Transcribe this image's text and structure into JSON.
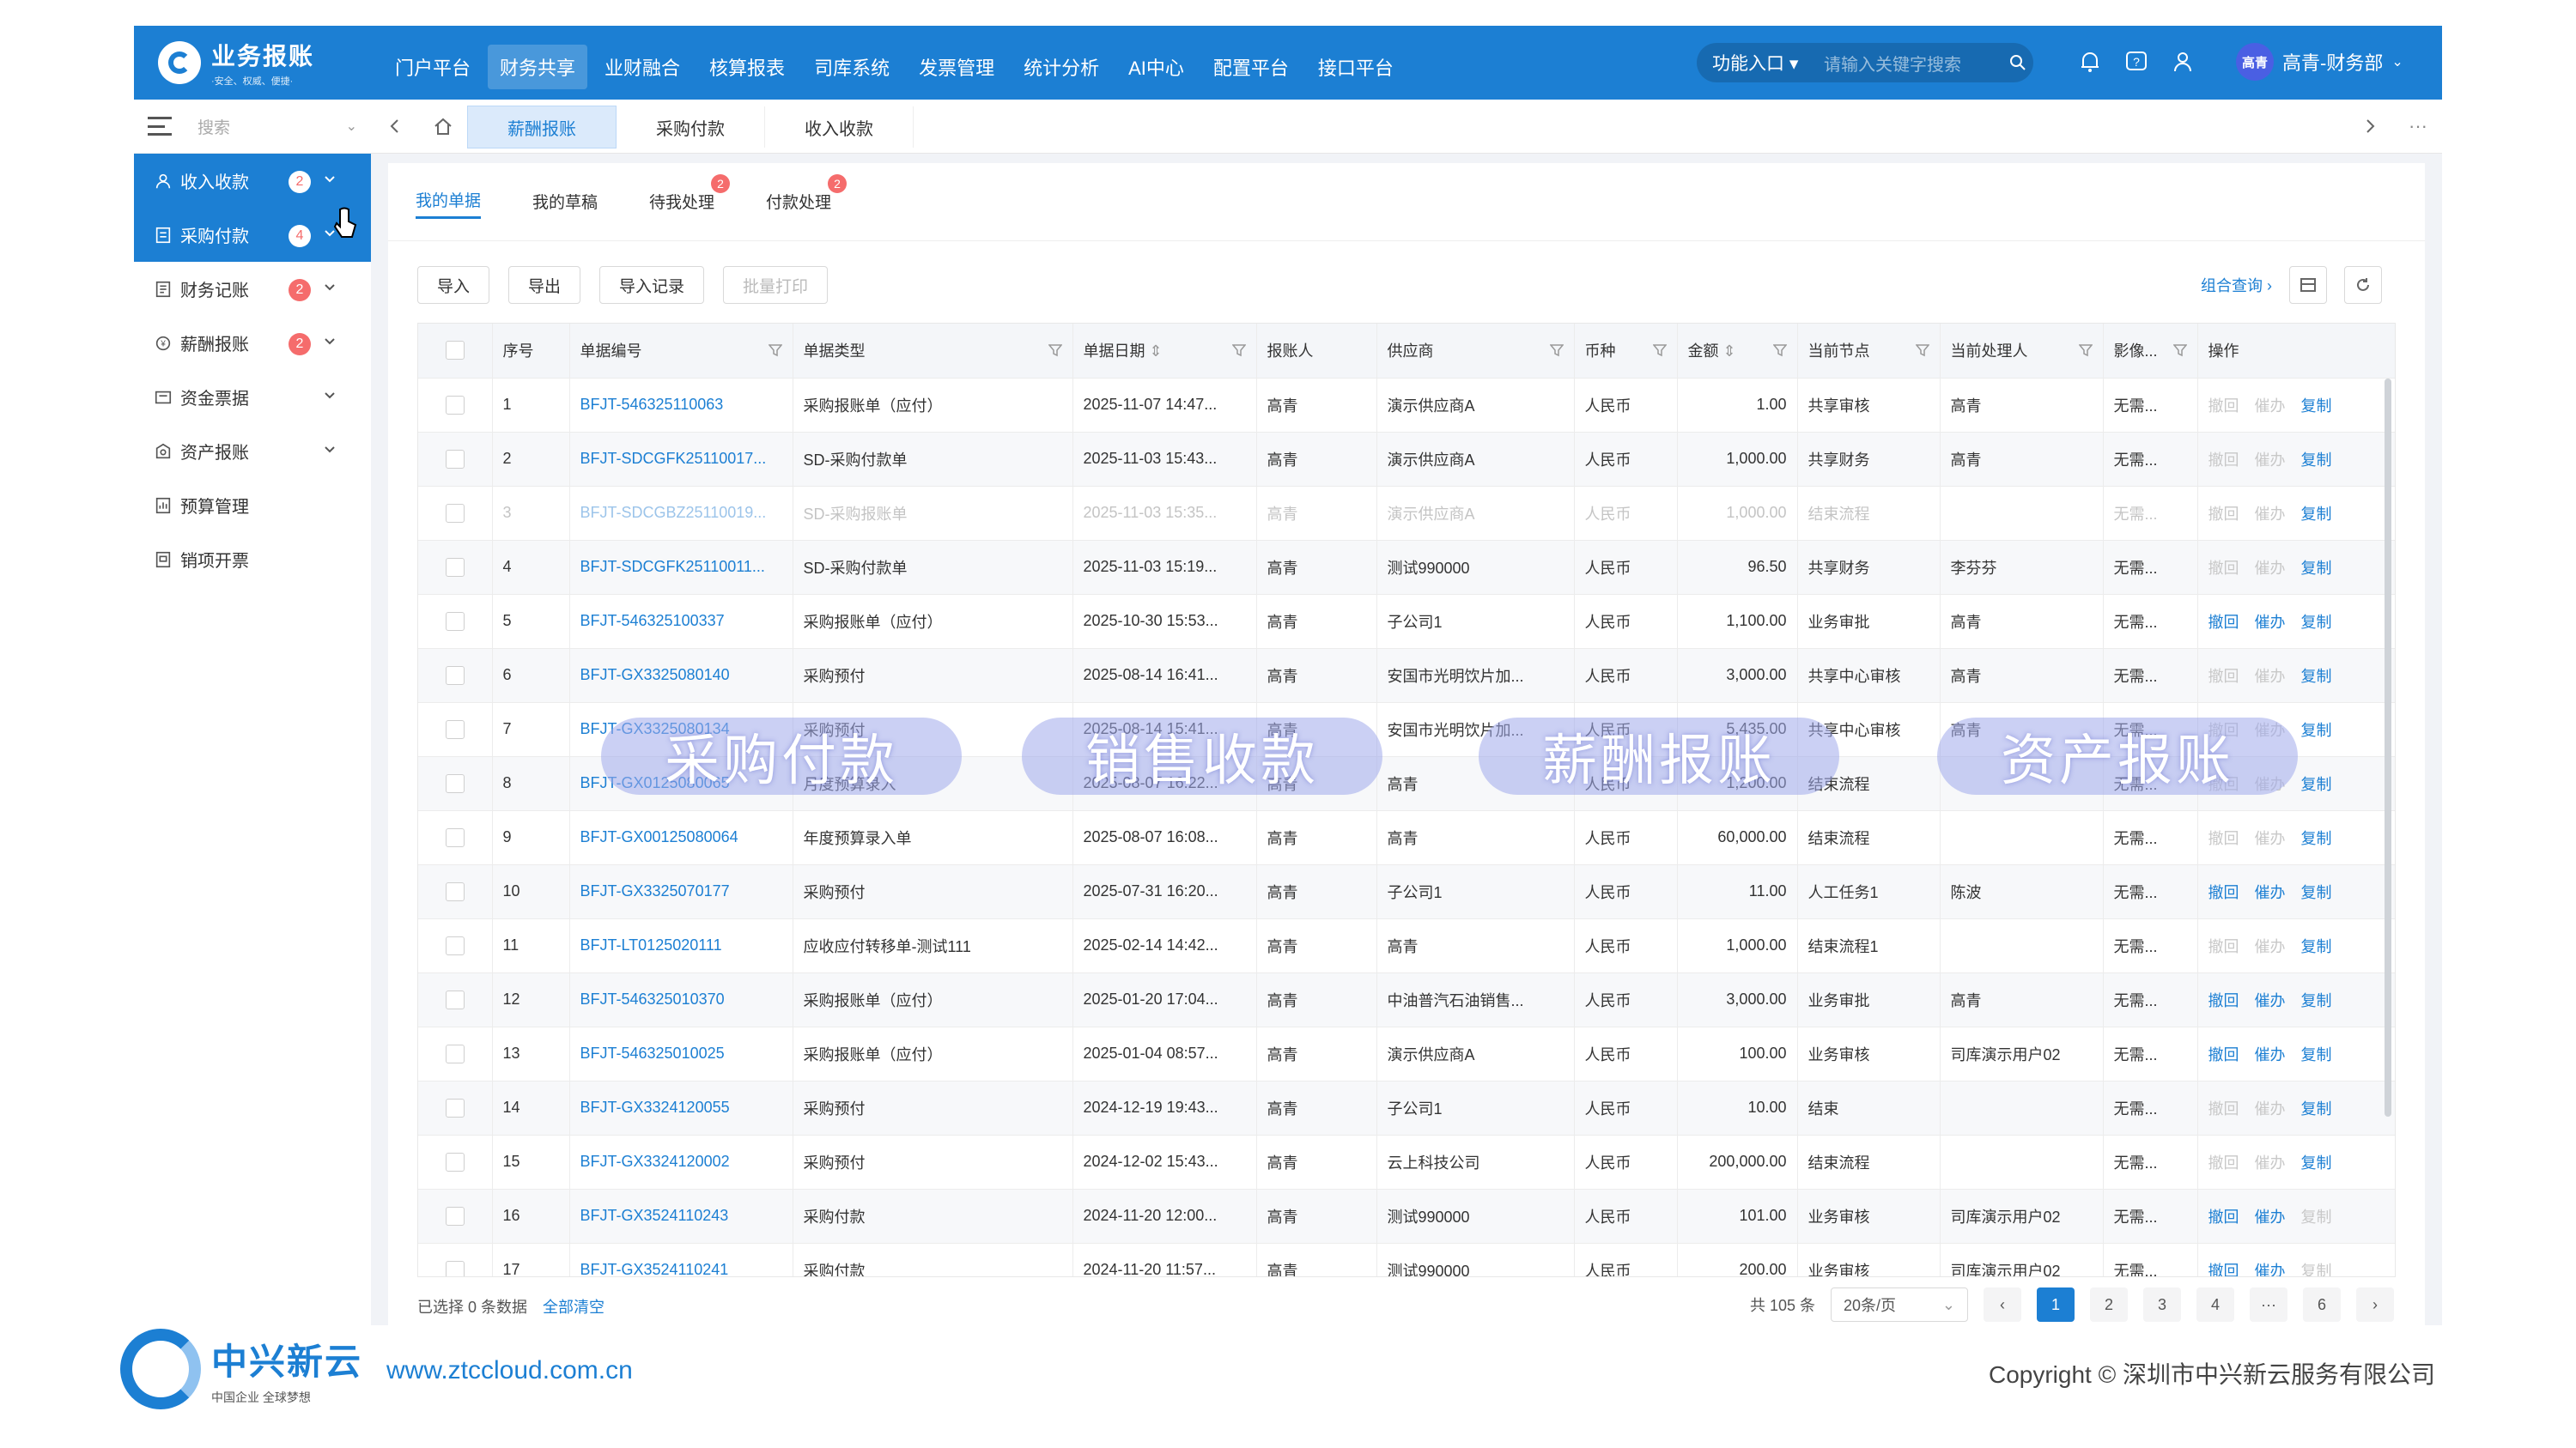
{
  "header": {
    "logo_title": "业务报账",
    "logo_sub": "·安全、权威、便捷·",
    "nav": [
      "门户平台",
      "财务共享",
      "业财融合",
      "核算报表",
      "司库系统",
      "发票管理",
      "统计分析",
      "AI中心",
      "配置平台",
      "接口平台"
    ],
    "func_label": "功能入口",
    "search_placeholder": "请输入关键字搜索",
    "avatar_text": "高青",
    "user_name": "高青-财务部"
  },
  "sidebar": {
    "search_placeholder": "搜索",
    "items": [
      {
        "label": "收入收款",
        "badge": "2",
        "icon": "user-icon",
        "active": true
      },
      {
        "label": "采购付款",
        "badge": "4",
        "icon": "document-icon",
        "active": true
      },
      {
        "label": "财务记账",
        "badge": "2",
        "icon": "ledger-icon"
      },
      {
        "label": "薪酬报账",
        "badge": "2",
        "icon": "coin-icon"
      },
      {
        "label": "资金票据",
        "badge": "",
        "icon": "bill-icon"
      },
      {
        "label": "资产报账",
        "badge": "",
        "icon": "asset-icon"
      },
      {
        "label": "预算管理",
        "badge": "",
        "icon": "budget-icon"
      },
      {
        "label": "销项开票",
        "badge": "",
        "icon": "invoice-icon"
      }
    ]
  },
  "tabs": [
    "薪酬报账",
    "采购付款",
    "收入收款"
  ],
  "subtabs": [
    {
      "label": "我的单据",
      "badge": ""
    },
    {
      "label": "我的草稿",
      "badge": ""
    },
    {
      "label": "待我处理",
      "badge": "2"
    },
    {
      "label": "付款处理",
      "badge": "2"
    }
  ],
  "toolbar": {
    "import": "导入",
    "export": "导出",
    "import_log": "导入记录",
    "batch_print": "批量打印",
    "combo_query": "组合查询 ›"
  },
  "table": {
    "headers": [
      "序号",
      "单据编号",
      "单据类型",
      "单据日期",
      "报账人",
      "供应商",
      "币种",
      "金额",
      "当前节点",
      "当前处理人",
      "影像...",
      "操作"
    ],
    "ops": [
      "撤回",
      "催办",
      "复制"
    ],
    "rows": [
      {
        "no": "1",
        "code": "BFJT-546325110063",
        "type": "采购报账单（应付）",
        "date": "2025-11-07 14:47...",
        "person": "高青",
        "supplier": "演示供应商A",
        "cur": "人民币",
        "amt": "1.00",
        "node": "共享审核",
        "handler": "高青",
        "img": "无需...",
        "op": [
          0,
          0,
          1
        ]
      },
      {
        "no": "2",
        "code": "BFJT-SDCGFK25110017...",
        "type": "SD-采购付款单",
        "date": "2025-11-03 15:43...",
        "person": "高青",
        "supplier": "演示供应商A",
        "cur": "人民币",
        "amt": "1,000.00",
        "node": "共享财务",
        "handler": "高青",
        "img": "无需...",
        "op": [
          0,
          0,
          1
        ]
      },
      {
        "no": "3",
        "code": "BFJT-SDCGBZ25110019...",
        "type": "SD-采购报账单",
        "date": "2025-11-03 15:35...",
        "person": "高青",
        "supplier": "演示供应商A",
        "cur": "人民币",
        "amt": "1,000.00",
        "node": "结束流程",
        "handler": "",
        "img": "无需...",
        "op": [
          0,
          0,
          1
        ],
        "dim": true
      },
      {
        "no": "4",
        "code": "BFJT-SDCGFK25110011...",
        "type": "SD-采购付款单",
        "date": "2025-11-03 15:19...",
        "person": "高青",
        "supplier": "测试990000",
        "cur": "人民币",
        "amt": "96.50",
        "node": "共享财务",
        "handler": "李芬芬",
        "img": "无需...",
        "op": [
          0,
          0,
          1
        ]
      },
      {
        "no": "5",
        "code": "BFJT-546325100337",
        "type": "采购报账单（应付）",
        "date": "2025-10-30 15:53...",
        "person": "高青",
        "supplier": "子公司1",
        "cur": "人民币",
        "amt": "1,100.00",
        "node": "业务审批",
        "handler": "高青",
        "img": "无需...",
        "op": [
          1,
          1,
          1
        ]
      },
      {
        "no": "6",
        "code": "BFJT-GX3325080140",
        "type": "采购预付",
        "date": "2025-08-14 16:41...",
        "person": "高青",
        "supplier": "安国市光明饮片加...",
        "cur": "人民币",
        "amt": "3,000.00",
        "node": "共享中心审核",
        "handler": "高青",
        "img": "无需...",
        "op": [
          0,
          0,
          1
        ]
      },
      {
        "no": "7",
        "code": "BFJT-GX3325080134",
        "type": "采购预付",
        "date": "2025-08-14 15:41...",
        "person": "高青",
        "supplier": "安国市光明饮片加...",
        "cur": "人民币",
        "amt": "5,435.00",
        "node": "共享中心审核",
        "handler": "高青",
        "img": "无需...",
        "op": [
          0,
          0,
          1
        ]
      },
      {
        "no": "8",
        "code": "BFJT-GX0125080065",
        "type": "月度预算录入",
        "date": "2025-08-07 16:22...",
        "person": "高青",
        "supplier": "高青",
        "cur": "人民币",
        "amt": "1,200.00",
        "node": "结束流程",
        "handler": "",
        "img": "无需...",
        "op": [
          0,
          0,
          1
        ]
      },
      {
        "no": "9",
        "code": "BFJT-GX00125080064",
        "type": "年度预算录入单",
        "date": "2025-08-07 16:08...",
        "person": "高青",
        "supplier": "高青",
        "cur": "人民币",
        "amt": "60,000.00",
        "node": "结束流程",
        "handler": "",
        "img": "无需...",
        "op": [
          0,
          0,
          1
        ]
      },
      {
        "no": "10",
        "code": "BFJT-GX3325070177",
        "type": "采购预付",
        "date": "2025-07-31 16:20...",
        "person": "高青",
        "supplier": "子公司1",
        "cur": "人民币",
        "amt": "11.00",
        "node": "人工任务1",
        "handler": "陈波",
        "img": "无需...",
        "op": [
          1,
          1,
          1
        ]
      },
      {
        "no": "11",
        "code": "BFJT-LT0125020111",
        "type": "应收应付转移单-测试111",
        "date": "2025-02-14 14:42...",
        "person": "高青",
        "supplier": "高青",
        "cur": "人民币",
        "amt": "1,000.00",
        "node": "结束流程1",
        "handler": "",
        "img": "无需...",
        "op": [
          0,
          0,
          1
        ]
      },
      {
        "no": "12",
        "code": "BFJT-546325010370",
        "type": "采购报账单（应付）",
        "date": "2025-01-20 17:04...",
        "person": "高青",
        "supplier": "中油普汽石油销售...",
        "cur": "人民币",
        "amt": "3,000.00",
        "node": "业务审批",
        "handler": "高青",
        "img": "无需...",
        "op": [
          1,
          1,
          1
        ]
      },
      {
        "no": "13",
        "code": "BFJT-546325010025",
        "type": "采购报账单（应付）",
        "date": "2025-01-04 08:57...",
        "person": "高青",
        "supplier": "演示供应商A",
        "cur": "人民币",
        "amt": "100.00",
        "node": "业务审核",
        "handler": "司库演示用户02",
        "img": "无需...",
        "op": [
          1,
          1,
          1
        ]
      },
      {
        "no": "14",
        "code": "BFJT-GX3324120055",
        "type": "采购预付",
        "date": "2024-12-19 19:43...",
        "person": "高青",
        "supplier": "子公司1",
        "cur": "人民币",
        "amt": "10.00",
        "node": "结束",
        "handler": "",
        "img": "无需...",
        "op": [
          0,
          0,
          1
        ]
      },
      {
        "no": "15",
        "code": "BFJT-GX3324120002",
        "type": "采购预付",
        "date": "2024-12-02 15:43...",
        "person": "高青",
        "supplier": "云上科技公司",
        "cur": "人民币",
        "amt": "200,000.00",
        "node": "结束流程",
        "handler": "",
        "img": "无需...",
        "op": [
          0,
          0,
          1
        ]
      },
      {
        "no": "16",
        "code": "BFJT-GX3524110243",
        "type": "采购付款",
        "date": "2024-11-20 12:00...",
        "person": "高青",
        "supplier": "测试990000",
        "cur": "人民币",
        "amt": "101.00",
        "node": "业务审核",
        "handler": "司库演示用户02",
        "img": "无需...",
        "op": [
          1,
          1,
          0
        ]
      },
      {
        "no": "17",
        "code": "BFJT-GX3524110241",
        "type": "采购付款",
        "date": "2024-11-20 11:57...",
        "person": "高青",
        "supplier": "测试990000",
        "cur": "人民币",
        "amt": "200.00",
        "node": "业务审核",
        "handler": "司库演示用户02",
        "img": "无需...",
        "op": [
          1,
          1,
          0
        ]
      }
    ]
  },
  "overlay_pills": [
    "采购付款",
    "销售收款",
    "薪酬报账",
    "资产报账"
  ],
  "footer": {
    "selected_text": "已选择 0 条数据",
    "clear_text": "全部清空",
    "total_text": "共 105 条",
    "page_size": "20条/页",
    "pages": [
      "1",
      "2",
      "3",
      "4",
      "···",
      "6"
    ]
  },
  "brand": {
    "name": "中兴新云",
    "slogan": "中国企业 全球梦想",
    "site": "www.ztccloud.com.cn",
    "copyright": "Copyright © 深圳市中兴新云服务有限公司"
  },
  "colors": {
    "primary": "#1c7fd3",
    "badge": "#f56c6c"
  }
}
